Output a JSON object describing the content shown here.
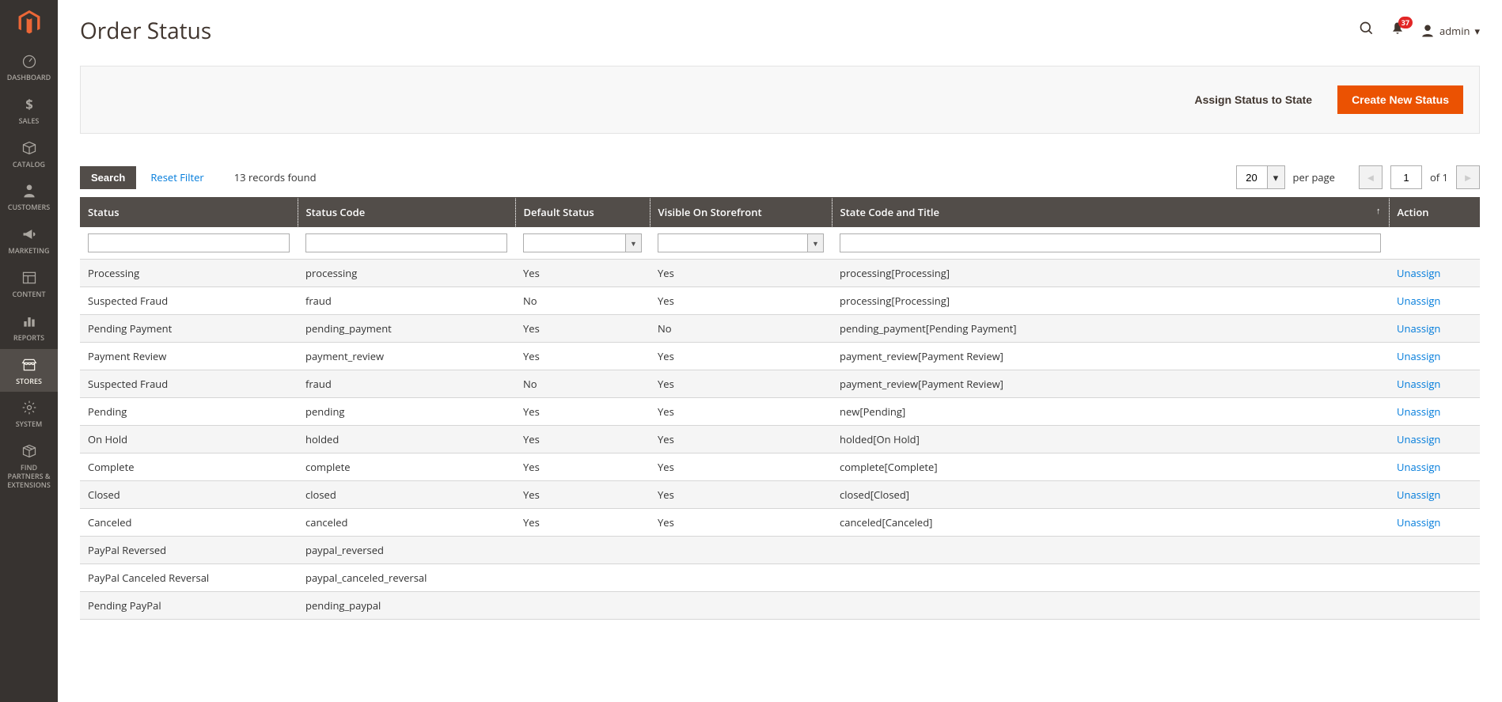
{
  "sidebar": {
    "items": [
      {
        "label": "DASHBOARD",
        "icon": "dashboard"
      },
      {
        "label": "SALES",
        "icon": "dollar"
      },
      {
        "label": "CATALOG",
        "icon": "box"
      },
      {
        "label": "CUSTOMERS",
        "icon": "person"
      },
      {
        "label": "MARKETING",
        "icon": "megaphone"
      },
      {
        "label": "CONTENT",
        "icon": "layout"
      },
      {
        "label": "REPORTS",
        "icon": "bars"
      },
      {
        "label": "STORES",
        "icon": "storefront",
        "active": true
      },
      {
        "label": "SYSTEM",
        "icon": "gear"
      },
      {
        "label": "FIND PARTNERS & EXTENSIONS",
        "icon": "package"
      }
    ]
  },
  "header": {
    "title": "Order Status",
    "notif_count": "37",
    "user_name": "admin"
  },
  "actions": {
    "assign_label": "Assign Status to State",
    "create_label": "Create New Status"
  },
  "grid": {
    "search_label": "Search",
    "reset_label": "Reset Filter",
    "records_text": "13 records found",
    "per_page_value": "20",
    "per_page_label": "per page",
    "current_page": "1",
    "total_pages": "of 1",
    "columns": {
      "status": "Status",
      "code": "Status Code",
      "default": "Default Status",
      "visible": "Visible On Storefront",
      "state": "State Code and Title",
      "action": "Action"
    },
    "rows": [
      {
        "status": "Processing",
        "code": "processing",
        "default": "Yes",
        "visible": "Yes",
        "state": "processing[Processing]",
        "action": "Unassign"
      },
      {
        "status": "Suspected Fraud",
        "code": "fraud",
        "default": "No",
        "visible": "Yes",
        "state": "processing[Processing]",
        "action": "Unassign"
      },
      {
        "status": "Pending Payment",
        "code": "pending_payment",
        "default": "Yes",
        "visible": "No",
        "state": "pending_payment[Pending Payment]",
        "action": "Unassign"
      },
      {
        "status": "Payment Review",
        "code": "payment_review",
        "default": "Yes",
        "visible": "Yes",
        "state": "payment_review[Payment Review]",
        "action": "Unassign"
      },
      {
        "status": "Suspected Fraud",
        "code": "fraud",
        "default": "No",
        "visible": "Yes",
        "state": "payment_review[Payment Review]",
        "action": "Unassign"
      },
      {
        "status": "Pending",
        "code": "pending",
        "default": "Yes",
        "visible": "Yes",
        "state": "new[Pending]",
        "action": "Unassign"
      },
      {
        "status": "On Hold",
        "code": "holded",
        "default": "Yes",
        "visible": "Yes",
        "state": "holded[On Hold]",
        "action": "Unassign"
      },
      {
        "status": "Complete",
        "code": "complete",
        "default": "Yes",
        "visible": "Yes",
        "state": "complete[Complete]",
        "action": "Unassign"
      },
      {
        "status": "Closed",
        "code": "closed",
        "default": "Yes",
        "visible": "Yes",
        "state": "closed[Closed]",
        "action": "Unassign"
      },
      {
        "status": "Canceled",
        "code": "canceled",
        "default": "Yes",
        "visible": "Yes",
        "state": "canceled[Canceled]",
        "action": "Unassign"
      },
      {
        "status": "PayPal Reversed",
        "code": "paypal_reversed",
        "default": "",
        "visible": "",
        "state": "",
        "action": ""
      },
      {
        "status": "PayPal Canceled Reversal",
        "code": "paypal_canceled_reversal",
        "default": "",
        "visible": "",
        "state": "",
        "action": ""
      },
      {
        "status": "Pending PayPal",
        "code": "pending_paypal",
        "default": "",
        "visible": "",
        "state": "",
        "action": ""
      }
    ]
  }
}
